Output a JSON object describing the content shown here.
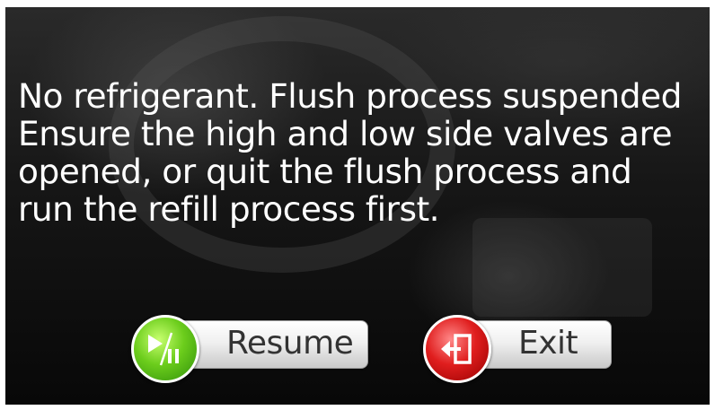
{
  "message": {
    "lines": [
      "No refrigerant. Flush process suspended",
      "Ensure the high and low side valves are",
      "opened, or quit the flush process and",
      "run the refill process first."
    ]
  },
  "buttons": {
    "resume": {
      "label": "Resume",
      "icon": "play-pause-icon",
      "color": "#5cbf1a"
    },
    "exit": {
      "label": "Exit",
      "icon": "exit-door-icon",
      "color": "#d81b1b"
    }
  }
}
